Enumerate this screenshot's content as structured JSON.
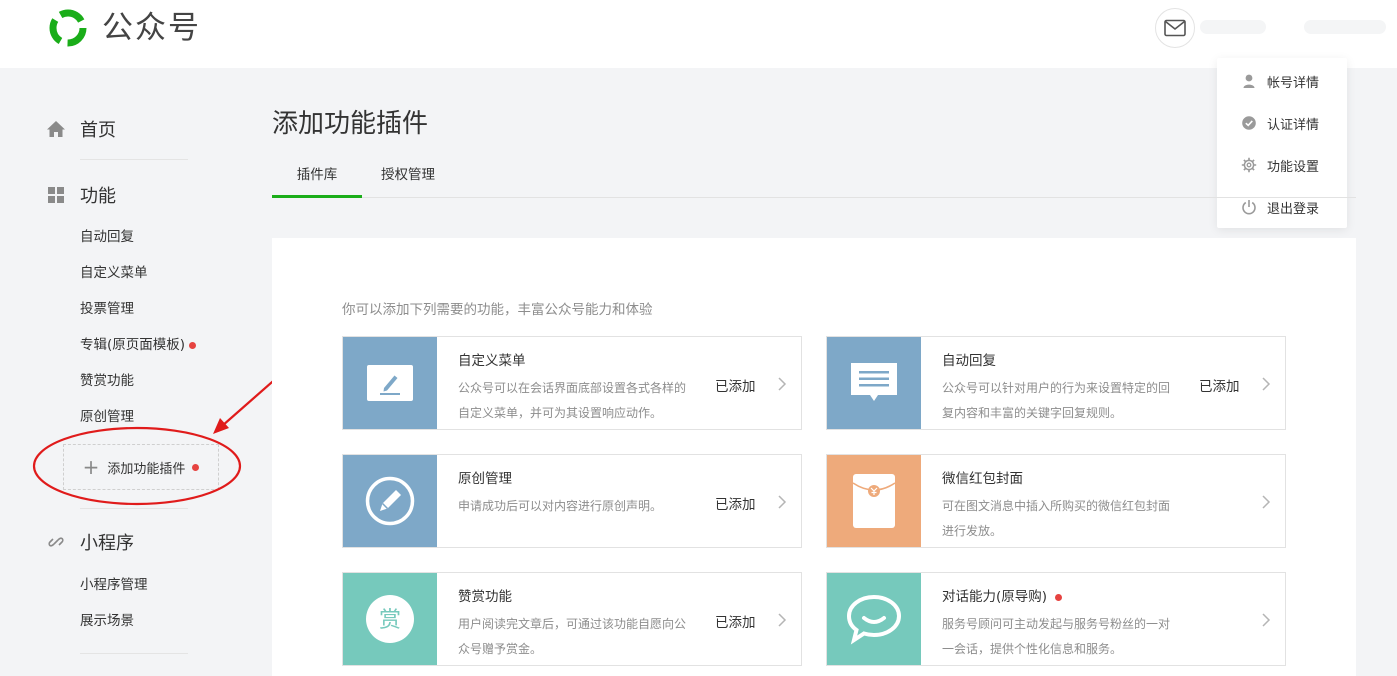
{
  "header": {
    "brand": "公众号"
  },
  "account_menu": {
    "items": [
      {
        "label": "帐号详情",
        "icon": "person-icon"
      },
      {
        "label": "认证详情",
        "icon": "verified-check-icon"
      },
      {
        "label": "功能设置",
        "icon": "gear-icon"
      },
      {
        "label": "退出登录",
        "icon": "power-icon"
      }
    ]
  },
  "sidebar": {
    "home": "首页",
    "features": {
      "title": "功能",
      "items": [
        "自动回复",
        "自定义菜单",
        "投票管理",
        "专辑(原页面模板)",
        "赞赏功能",
        "原创管理"
      ],
      "add_plugin": "添加功能插件"
    },
    "miniprogram": {
      "title": "小程序",
      "items": [
        "小程序管理",
        "展示场景"
      ]
    }
  },
  "main": {
    "title": "添加功能插件",
    "tabs": [
      "插件库",
      "授权管理"
    ],
    "active_tab": 0,
    "intro": "你可以添加下列需要的功能，丰富公众号能力和体验",
    "cards": [
      {
        "title": "自定义菜单",
        "desc": "公众号可以在会话界面底部设置各式各样的自定义菜单，并可为其设置响应动作。",
        "status": "已添加",
        "icon": "edit-icon",
        "color": "#7ea8c8"
      },
      {
        "title": "自动回复",
        "desc": "公众号可以针对用户的行为来设置特定的回复内容和丰富的关键字回复规则。",
        "status": "已添加",
        "icon": "message-icon",
        "color": "#7ea8c8"
      },
      {
        "title": "原创管理",
        "desc": "申请成功后可以对内容进行原创声明。",
        "status": "已添加",
        "icon": "pen-circle-icon",
        "color": "#7ea8c8"
      },
      {
        "title": "微信红包封面",
        "desc": "可在图文消息中插入所购买的微信红包封面进行发放。",
        "status": "",
        "icon": "red-packet-icon",
        "color": "#eeaa7b"
      },
      {
        "title": "赞赏功能",
        "desc": "用户阅读完文章后，可通过该功能自愿向公众号赠予赏金。",
        "status": "已添加",
        "icon": "reward-icon",
        "color": "#76c9bc"
      },
      {
        "title": "对话能力(原导购)",
        "desc": "服务号顾问可主动发起与服务号粉丝的一对一会话，提供个性化信息和服务。",
        "status": "",
        "icon": "chat-bubble-icon",
        "color": "#76c9bc"
      }
    ]
  },
  "colors": {
    "accent_green": "#1aad19",
    "badge_red": "#e64340",
    "annotation_red": "#e01b1b"
  }
}
